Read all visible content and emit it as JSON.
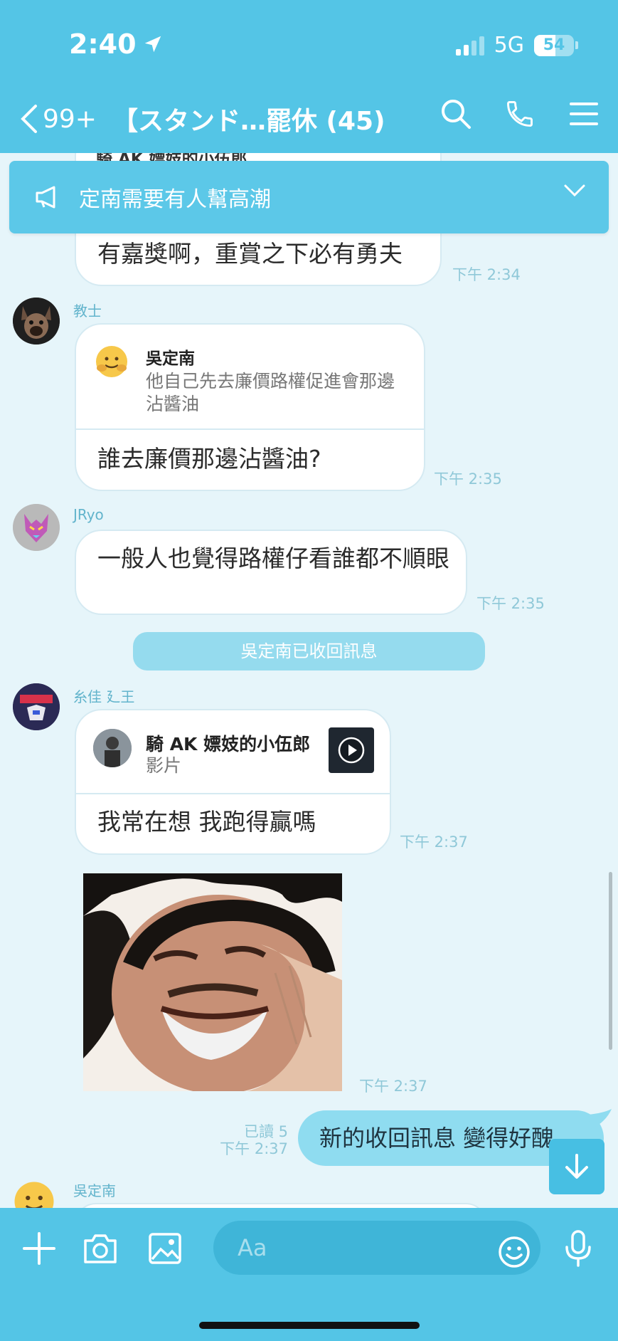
{
  "status": {
    "time": "2:40",
    "network": "5G",
    "battery": "54",
    "battery_level": 0.54
  },
  "nav": {
    "back_count": "99+",
    "title": "【スタンド…罷休 (45)"
  },
  "announcement": {
    "text": "定南需要有人幫高潮"
  },
  "messages": {
    "m0": {
      "partial_header": "騎 AK 嫖妓的小伍郎",
      "text": "有嘉獎啊，重賞之下必有勇夫",
      "time": "下午 2:34"
    },
    "m1": {
      "sender": "教士",
      "quote_name": "吳定南",
      "quote_text": "他自己先去廉價路權促進會那邊沾醬油",
      "text": "誰去廉價那邊沾醬油?",
      "time": "下午 2:35"
    },
    "m2": {
      "sender": "JRyo",
      "text": "一般人也覺得路權仔看誰都不順眼",
      "time": "下午 2:35"
    },
    "system": "吳定南已收回訊息",
    "m3": {
      "sender": "糸佳 廴王",
      "video_title": "騎 AK 嫖妓的小伍郎",
      "video_sub": "影片",
      "text": "我常在想 我跑得贏嗎",
      "time": "下午 2:37"
    },
    "m4": {
      "time": "下午 2:37"
    },
    "m5": {
      "read": "已讀 5",
      "time": "下午 2:37",
      "text": "新的收回訊息 變得好醜"
    },
    "m6": {
      "sender": "吳定南"
    }
  },
  "input": {
    "placeholder": "Aa"
  },
  "colors": {
    "header": "#54c5e6",
    "chat_bg": "#e6f5fa",
    "my_bubble": "#8fdcf0",
    "system": "#95dbee"
  }
}
